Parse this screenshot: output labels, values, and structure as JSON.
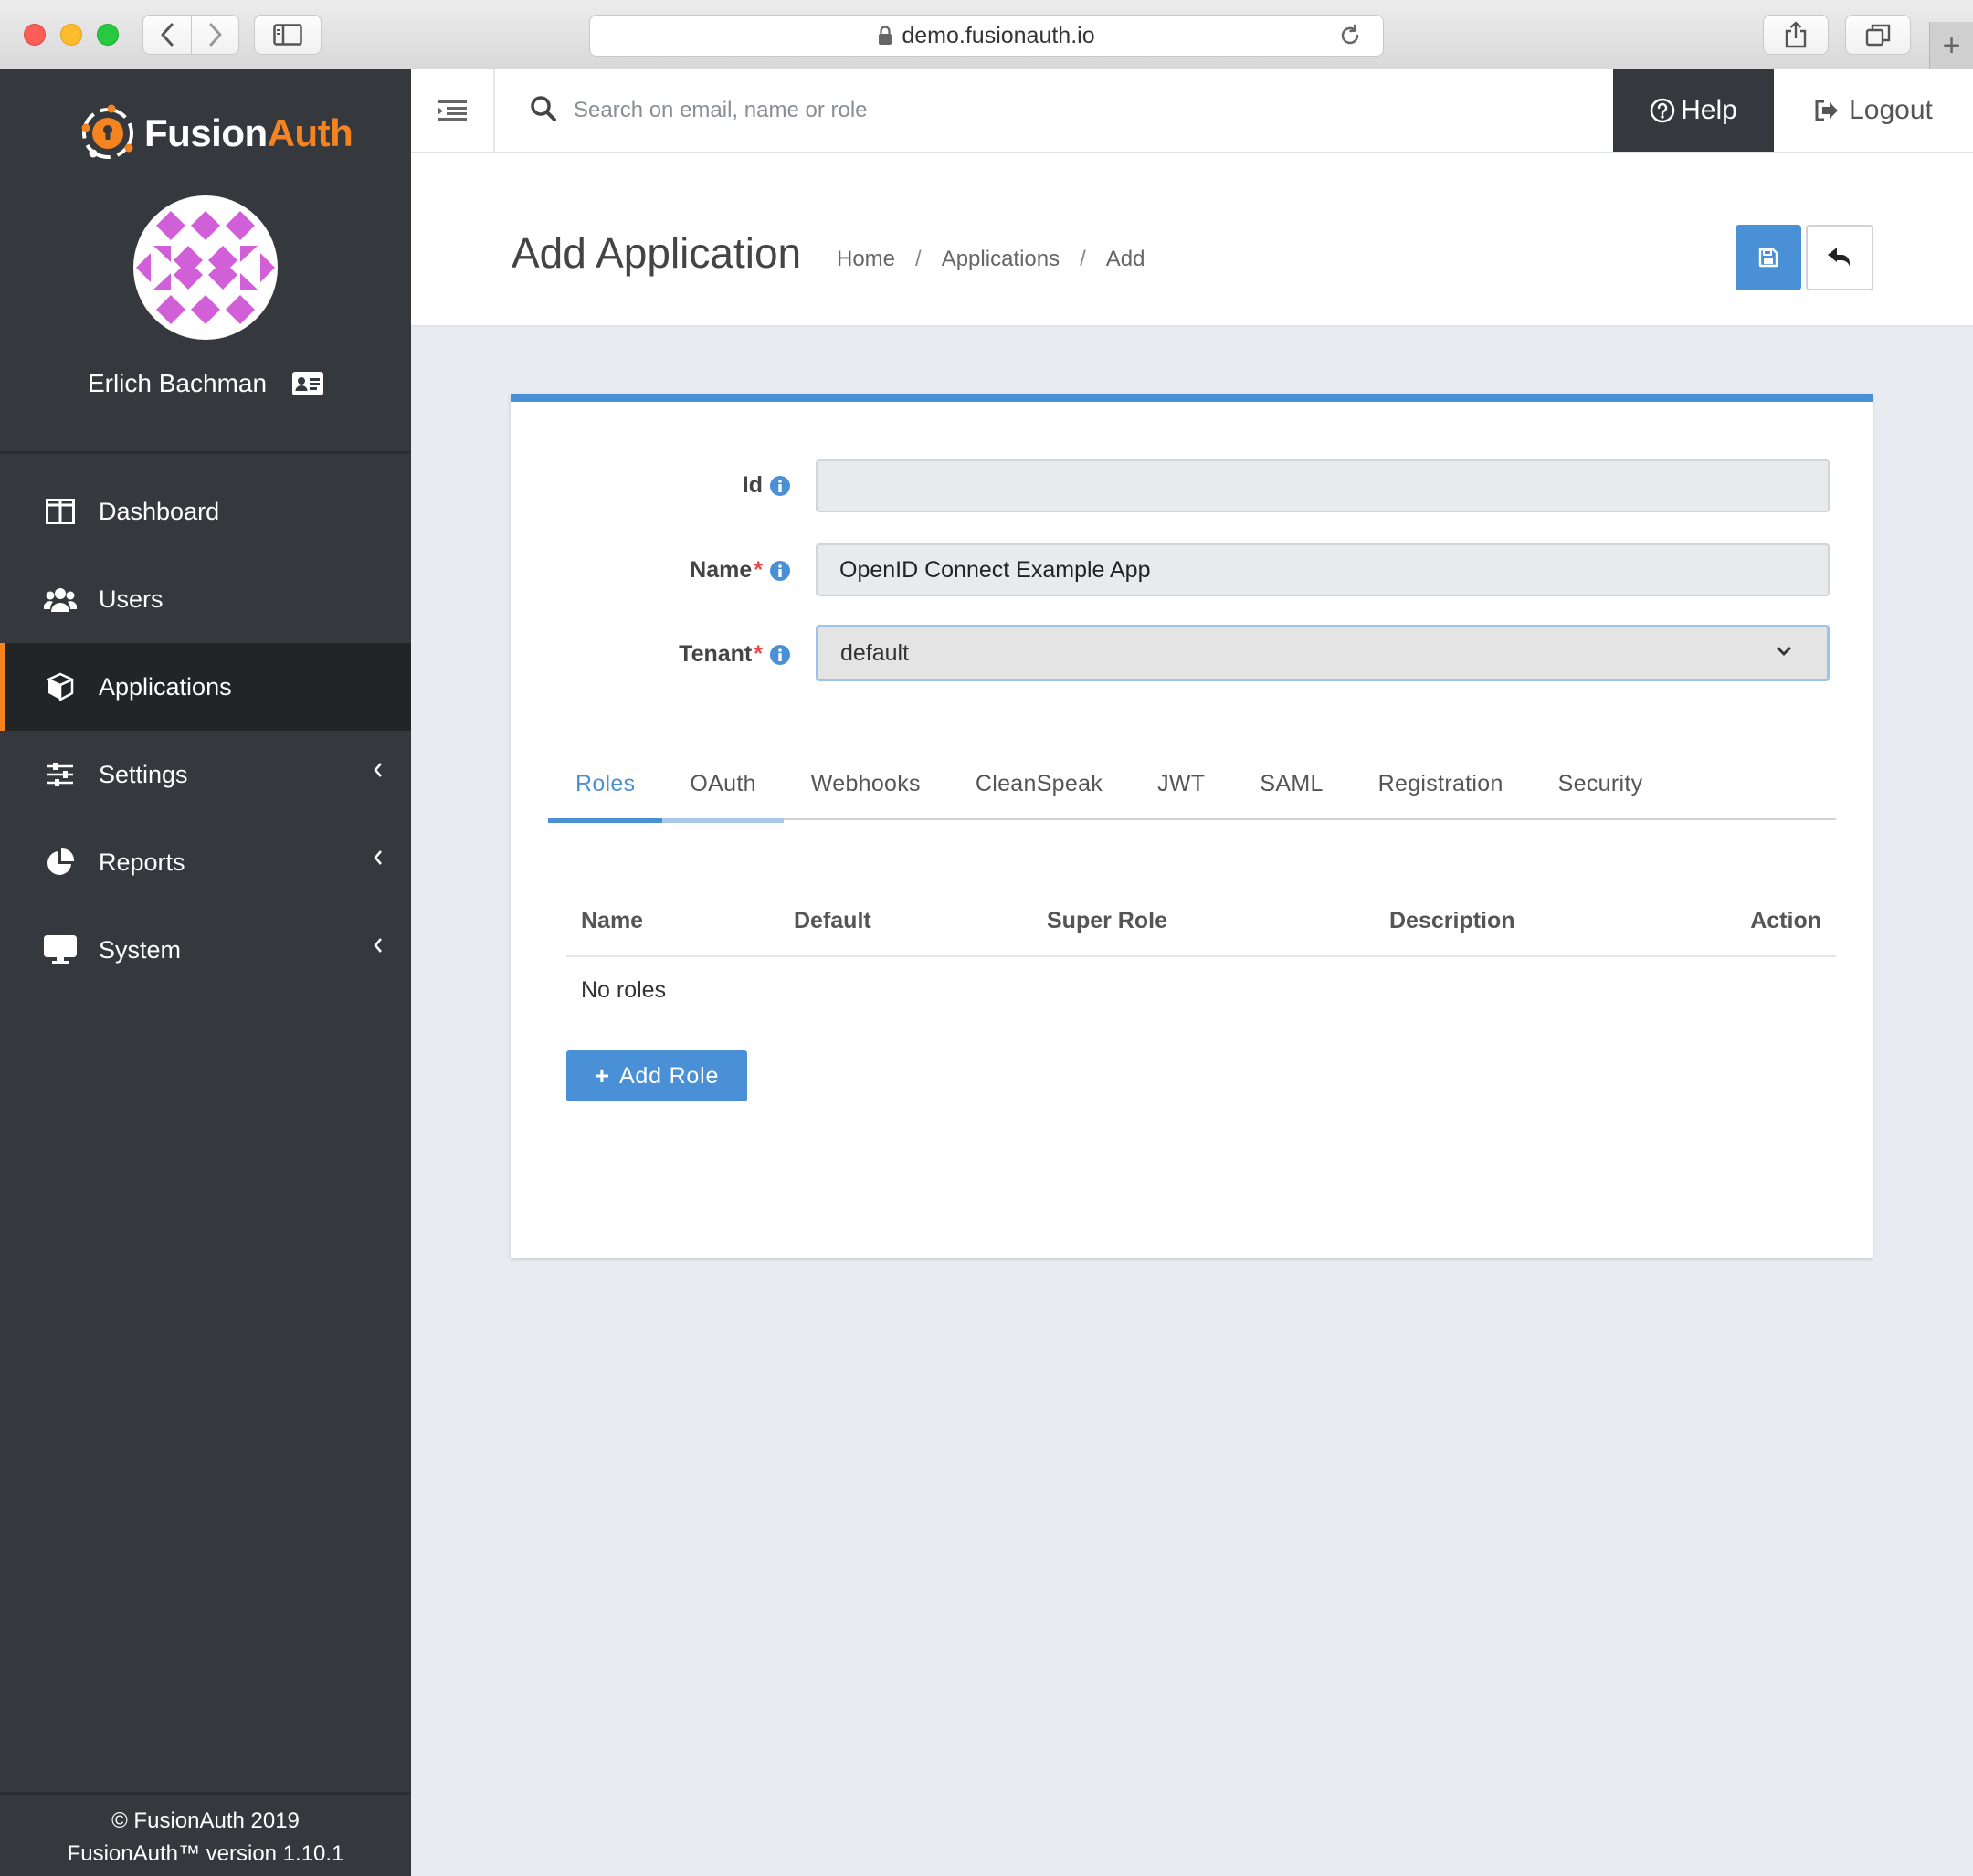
{
  "browser": {
    "url": "demo.fusionauth.io"
  },
  "sidebar": {
    "logo_fusion": "Fusion",
    "logo_auth": "Auth",
    "user_name": "Erlich Bachman",
    "items": [
      {
        "label": "Dashboard",
        "icon": "columns-icon"
      },
      {
        "label": "Users",
        "icon": "users-icon"
      },
      {
        "label": "Applications",
        "icon": "cube-icon",
        "active": true
      },
      {
        "label": "Settings",
        "icon": "sliders-icon"
      },
      {
        "label": "Reports",
        "icon": "pie-chart-icon"
      },
      {
        "label": "System",
        "icon": "desktop-icon"
      }
    ],
    "footer_copyright": "© FusionAuth 2019",
    "footer_version": "FusionAuth™ version 1.10.1"
  },
  "topbar": {
    "search_placeholder": "Search on email, name or role",
    "help_label": "Help",
    "logout_label": "Logout"
  },
  "header": {
    "title": "Add Application",
    "breadcrumb": [
      "Home",
      "Applications",
      "Add"
    ]
  },
  "form": {
    "id_label": "Id",
    "id_value": "",
    "name_label": "Name",
    "name_value": "OpenID Connect Example App",
    "tenant_label": "Tenant",
    "tenant_value": "default",
    "required_mark": "*"
  },
  "tabs": [
    "Roles",
    "OAuth",
    "Webhooks",
    "CleanSpeak",
    "JWT",
    "SAML",
    "Registration",
    "Security"
  ],
  "roles_table": {
    "headers": [
      "Name",
      "Default",
      "Super Role",
      "Description",
      "Action"
    ],
    "empty_text": "No roles"
  },
  "add_role_label": "Add Role",
  "colors": {
    "accent_blue": "#4a90d6",
    "brand_orange": "#f58320",
    "sidebar_bg": "#35393d",
    "required_red": "#e04b4b"
  }
}
